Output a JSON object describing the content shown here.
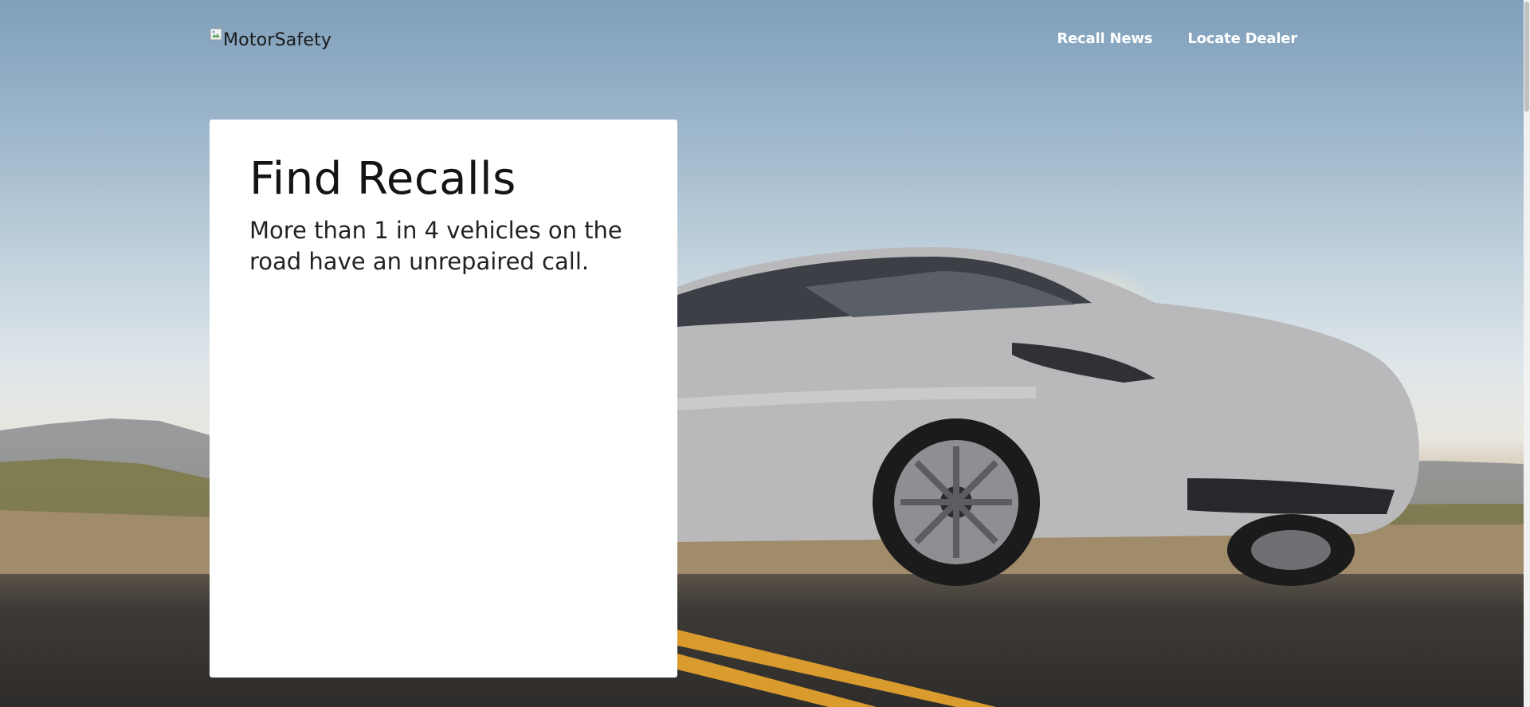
{
  "header": {
    "logo_alt": "MotorSafety",
    "nav": [
      {
        "label": "Recall News"
      },
      {
        "label": "Locate Dealer"
      }
    ]
  },
  "hero": {
    "title": "Find Recalls",
    "subtitle": "More than 1 in 4 vehicles on the road have an unrepaired call."
  },
  "colors": {
    "card_background": "#ffffff",
    "nav_text": "#ffffff",
    "title_text": "#141414"
  }
}
